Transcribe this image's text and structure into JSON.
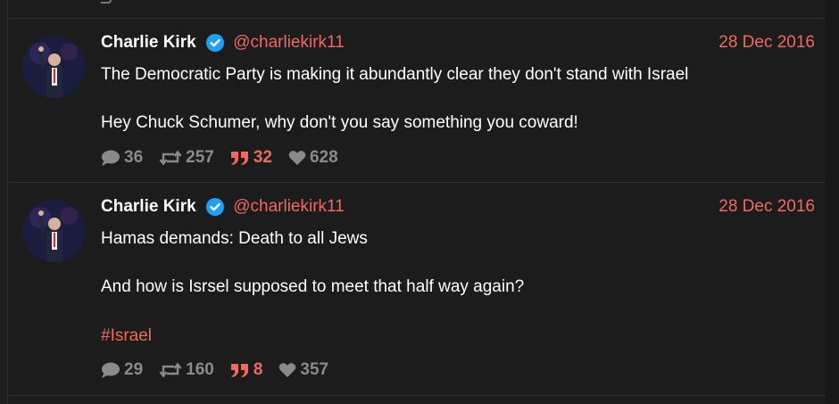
{
  "colors": {
    "accent": "#ef6a5d",
    "muted": "#8a8a8a",
    "background": "#1c1c1c",
    "verified": "#1da1f2"
  },
  "tweets": [
    {
      "name": "Charlie Kirk",
      "handle": "@charliekirk11",
      "date": "28 Dec 2016",
      "lines": [
        "The Democratic Party is making it abundantly clear they don't stand with Israel",
        "Hey Chuck Schumer, why don't you say something you coward!"
      ],
      "hashtag": "",
      "stats": {
        "replies": "36",
        "retweets": "257",
        "quotes": "32",
        "likes": "628"
      }
    },
    {
      "name": "Charlie Kirk",
      "handle": "@charliekirk11",
      "date": "28 Dec 2016",
      "lines": [
        "Hamas demands: Death to all Jews",
        "And how is Isrsel supposed to meet that half way again?"
      ],
      "hashtag": "#Israel",
      "stats": {
        "replies": "29",
        "retweets": "160",
        "quotes": "8",
        "likes": "357"
      }
    }
  ]
}
